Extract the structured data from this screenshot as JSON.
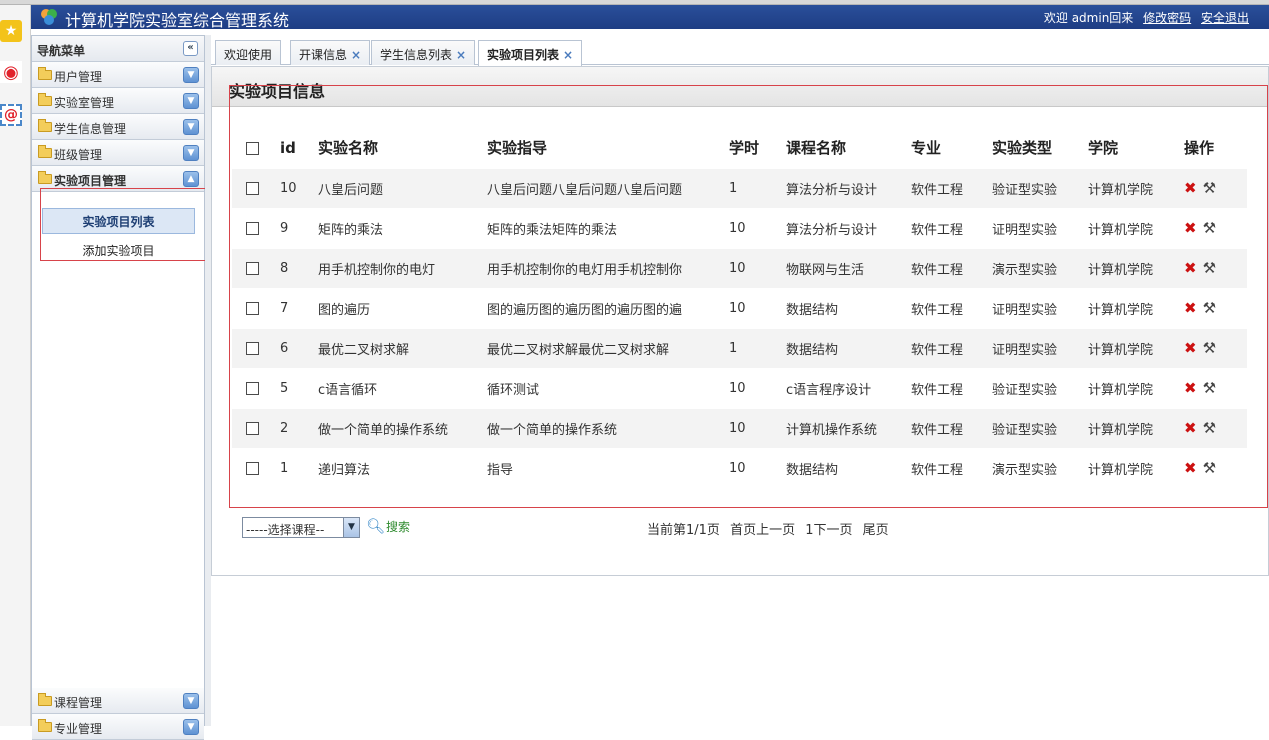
{
  "header": {
    "title": "计算机学院实验室综合管理系统",
    "welcome": "欢迎 admin回来",
    "change_password": "修改密码",
    "logout": "安全退出"
  },
  "sidebar": {
    "title": "导航菜单",
    "collapse_glyph": "«",
    "menus": [
      {
        "label": "用户管理"
      },
      {
        "label": "实验室管理"
      },
      {
        "label": "学生信息管理"
      },
      {
        "label": "班级管理"
      },
      {
        "label": "实验项目管理"
      }
    ],
    "submenu": [
      {
        "label": "实验项目列表"
      },
      {
        "label": "添加实验项目"
      }
    ],
    "bottom_menus": [
      {
        "label": "课程管理"
      },
      {
        "label": "专业管理"
      }
    ]
  },
  "tabs": [
    {
      "label": "欢迎使用",
      "closable": false
    },
    {
      "label": "开课信息",
      "closable": true
    },
    {
      "label": "学生信息列表",
      "closable": true
    },
    {
      "label": "实验项目列表",
      "closable": true
    }
  ],
  "tab_close_glyph": "×",
  "panel": {
    "title": "实验项目信息"
  },
  "table": {
    "headers": [
      "id",
      "实验名称",
      "实验指导",
      "学时",
      "课程名称",
      "专业",
      "实验类型",
      "学院",
      "操作"
    ],
    "rows": [
      [
        "10",
        "八皇后问题",
        "八皇后问题八皇后问题八皇后问题",
        "1",
        "算法分析与设计",
        "软件工程",
        "验证型实验",
        "计算机学院"
      ],
      [
        "9",
        "矩阵的乘法",
        "矩阵的乘法矩阵的乘法",
        "10",
        "算法分析与设计",
        "软件工程",
        "证明型实验",
        "计算机学院"
      ],
      [
        "8",
        "用手机控制你的电灯",
        "用手机控制你的电灯用手机控制你",
        "10",
        "物联网与生活",
        "软件工程",
        "演示型实验",
        "计算机学院"
      ],
      [
        "7",
        "图的遍历",
        "图的遍历图的遍历图的遍历图的遍",
        "10",
        "数据结构",
        "软件工程",
        "证明型实验",
        "计算机学院"
      ],
      [
        "6",
        "最优二叉树求解",
        "最优二叉树求解最优二叉树求解",
        "1",
        "数据结构",
        "软件工程",
        "证明型实验",
        "计算机学院"
      ],
      [
        "5",
        "c语言循环",
        "循环测试",
        "10",
        "c语言程序设计",
        "软件工程",
        "验证型实验",
        "计算机学院"
      ],
      [
        "2",
        "做一个简单的操作系统",
        "做一个简单的操作系统",
        "10",
        "计算机操作系统",
        "软件工程",
        "验证型实验",
        "计算机学院"
      ],
      [
        "1",
        "递归算法",
        "指导",
        "10",
        "数据结构",
        "软件工程",
        "演示型实验",
        "计算机学院"
      ]
    ]
  },
  "filter": {
    "select_value": "-----选择课程--",
    "search_label": "搜索"
  },
  "pager": {
    "info": "当前第1/1页",
    "first_prev": "首页上一页",
    "next": "1下一页",
    "last": "尾页"
  },
  "colors": {
    "header_bg": "#1e3d84",
    "highlight_border": "#d7434a",
    "delete_icon": "#cc1111"
  }
}
